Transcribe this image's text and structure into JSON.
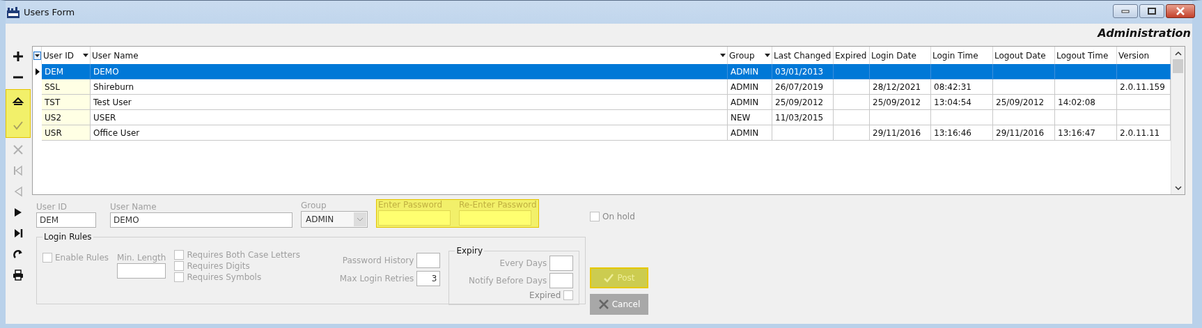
{
  "window": {
    "title": "Users Form"
  },
  "header": {
    "title": "Administration"
  },
  "toolbar": [
    {
      "kind": "add",
      "disabled": false,
      "highlighted": false
    },
    {
      "kind": "remove",
      "disabled": false,
      "highlighted": false
    },
    {
      "kind": "edit",
      "disabled": false,
      "highlighted": true
    },
    {
      "kind": "post",
      "disabled": true,
      "highlighted": true
    },
    {
      "kind": "cancel",
      "disabled": true,
      "highlighted": false
    },
    {
      "kind": "first",
      "disabled": true,
      "highlighted": false
    },
    {
      "kind": "prior",
      "disabled": true,
      "highlighted": false
    },
    {
      "kind": "next",
      "disabled": false,
      "highlighted": false
    },
    {
      "kind": "last",
      "disabled": false,
      "highlighted": false
    },
    {
      "kind": "refresh",
      "disabled": false,
      "highlighted": false
    },
    {
      "kind": "print",
      "disabled": false,
      "highlighted": false
    }
  ],
  "table": {
    "columns": [
      {
        "label": "User ID",
        "filter": true
      },
      {
        "label": "User Name",
        "filter": true
      },
      {
        "label": "Group",
        "filter": true
      },
      {
        "label": "Last Changed",
        "filter": false
      },
      {
        "label": "Expired",
        "filter": false
      },
      {
        "label": "Login Date",
        "filter": false
      },
      {
        "label": "Login Time",
        "filter": false
      },
      {
        "label": "Logout Date",
        "filter": false
      },
      {
        "label": "Logout Time",
        "filter": false
      },
      {
        "label": "Version",
        "filter": false
      }
    ],
    "rows": [
      {
        "selected": true,
        "cells": [
          "DEM",
          "DEMO",
          "ADMIN",
          "03/01/2013",
          "",
          "",
          "",
          "",
          "",
          ""
        ]
      },
      {
        "selected": false,
        "cells": [
          "SSL",
          "Shireburn",
          "ADMIN",
          "26/07/2019",
          "",
          "28/12/2021",
          "08:42:31",
          "",
          "",
          "2.0.11.159"
        ]
      },
      {
        "selected": false,
        "cells": [
          "TST",
          "Test User",
          "ADMIN",
          "25/09/2012",
          "",
          "25/09/2012",
          "13:04:54",
          "25/09/2012",
          "14:02:08",
          ""
        ]
      },
      {
        "selected": false,
        "cells": [
          "US2",
          "USER",
          "NEW",
          "11/03/2015",
          "",
          "",
          "",
          "",
          "",
          ""
        ]
      },
      {
        "selected": false,
        "cells": [
          "USR",
          "Office User",
          "ADMIN",
          "",
          "",
          "29/11/2016",
          "13:16:46",
          "29/11/2016",
          "13:16:47",
          "2.0.11.11"
        ]
      }
    ]
  },
  "form": {
    "user_id": {
      "label": "User ID",
      "value": "DEM"
    },
    "user_name": {
      "label": "User Name",
      "value": "DEMO"
    },
    "group": {
      "label": "Group",
      "value": "ADMIN"
    },
    "passwords": [
      {
        "label": "Enter Password"
      },
      {
        "label": "Re-Enter Password"
      }
    ],
    "on_hold": {
      "label": "On hold",
      "checked": false
    },
    "login_rules": {
      "title": "Login Rules",
      "enable_rules": {
        "label": "Enable Rules",
        "checked": false
      },
      "min_length": {
        "label": "Min. Length"
      },
      "requirements": [
        {
          "label": "Requires Both Case Letters",
          "checked": false
        },
        {
          "label": "Requires Digits",
          "checked": false
        },
        {
          "label": "Requires Symbols",
          "checked": false
        }
      ],
      "password_history": {
        "label": "Password History"
      },
      "max_login_retries": {
        "label": "Max Login Retries",
        "value": "3"
      },
      "expiry": {
        "title": "Expiry",
        "every_days": {
          "label": "Every Days"
        },
        "notify_before_days": {
          "label": "Notify Before Days"
        },
        "expired": {
          "label": "Expired",
          "checked": false
        }
      }
    },
    "buttons": [
      {
        "kind": "post",
        "label": "Post",
        "highlighted": true,
        "disabled": true
      },
      {
        "kind": "cancel",
        "label": "Cancel",
        "highlighted": false,
        "disabled": true
      }
    ]
  }
}
